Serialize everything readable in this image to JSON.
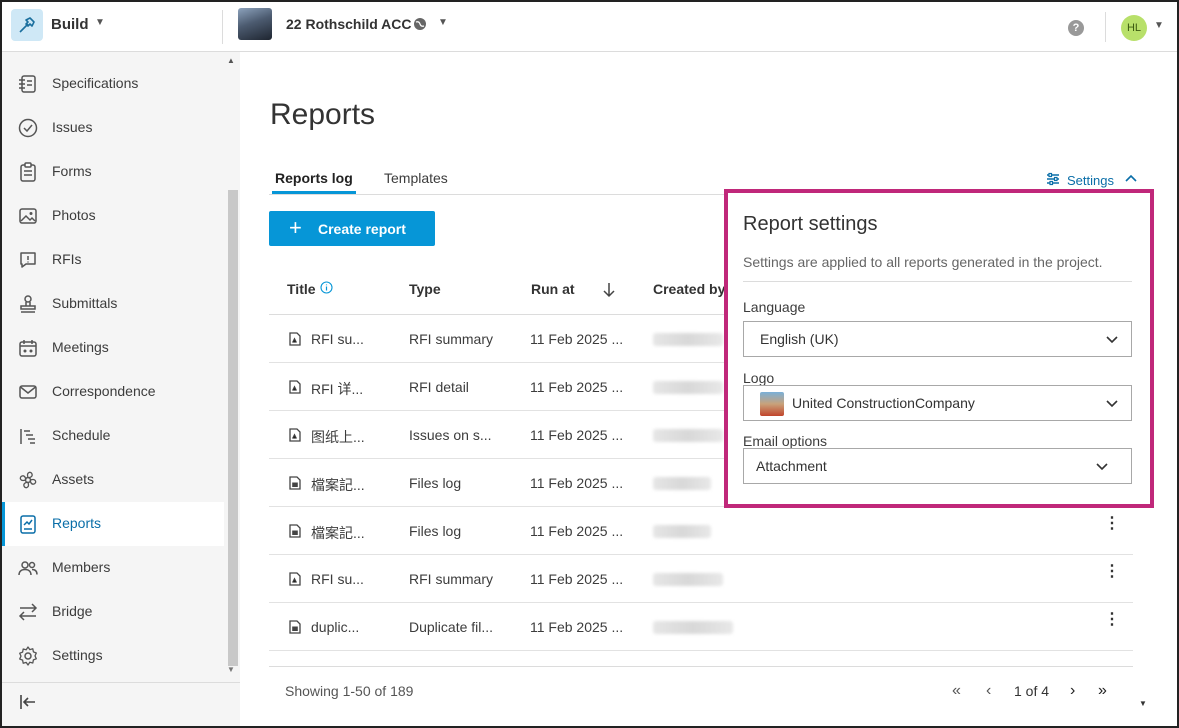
{
  "header": {
    "app_name": "Build",
    "project_name": "22 Rothschild ACC",
    "help_label": "?",
    "user_initials": "HL"
  },
  "sidebar": {
    "items": [
      {
        "label": "Specifications",
        "icon": "specifications-icon"
      },
      {
        "label": "Issues",
        "icon": "issues-icon"
      },
      {
        "label": "Forms",
        "icon": "forms-icon"
      },
      {
        "label": "Photos",
        "icon": "photos-icon"
      },
      {
        "label": "RFIs",
        "icon": "rfis-icon"
      },
      {
        "label": "Submittals",
        "icon": "submittals-icon"
      },
      {
        "label": "Meetings",
        "icon": "meetings-icon"
      },
      {
        "label": "Correspondence",
        "icon": "correspondence-icon"
      },
      {
        "label": "Schedule",
        "icon": "schedule-icon"
      },
      {
        "label": "Assets",
        "icon": "assets-icon"
      },
      {
        "label": "Reports",
        "icon": "reports-icon",
        "active": true
      },
      {
        "label": "Members",
        "icon": "members-icon"
      },
      {
        "label": "Bridge",
        "icon": "bridge-icon"
      },
      {
        "label": "Settings",
        "icon": "settings-icon"
      }
    ]
  },
  "main": {
    "title": "Reports",
    "tabs": [
      "Reports log",
      "Templates"
    ],
    "settings_link": "Settings",
    "create_button": "Create report",
    "columns": [
      "Title",
      "Type",
      "Run at",
      "Created by"
    ],
    "rows": [
      {
        "title": "RFI su...",
        "type": "RFI summary",
        "run_at": "11 Feb 2025 ...",
        "file_icon": "pdf-file-icon"
      },
      {
        "title": "RFI 详...",
        "type": "RFI detail",
        "run_at": "11 Feb 2025 ...",
        "file_icon": "pdf-file-icon"
      },
      {
        "title": "图纸上...",
        "type": "Issues on s...",
        "run_at": "11 Feb 2025 ...",
        "file_icon": "pdf-file-icon"
      },
      {
        "title": "檔案記...",
        "type": "Files log",
        "run_at": "11 Feb 2025 ...",
        "file_icon": "doc-file-icon"
      },
      {
        "title": "檔案記...",
        "type": "Files log",
        "run_at": "11 Feb 2025 ...",
        "file_icon": "doc-file-icon"
      },
      {
        "title": "RFI su...",
        "type": "RFI summary",
        "run_at": "11 Feb 2025 ...",
        "file_icon": "pdf-file-icon"
      },
      {
        "title": "duplic...",
        "type": "Duplicate fil...",
        "run_at": "11 Feb 2025 ...",
        "file_icon": "doc-file-icon"
      }
    ],
    "showing": "Showing 1-50 of 189",
    "page_of": "1 of 4"
  },
  "settings_panel": {
    "title": "Report settings",
    "description": "Settings are applied to all reports generated in the project.",
    "language_label": "Language",
    "language_value": "English (UK)",
    "logo_label": "Logo",
    "logo_value": "United ConstructionCompany",
    "email_label": "Email options",
    "email_value": "Attachment"
  },
  "colors": {
    "accent": "#0696d7",
    "highlight_border": "#c0287a",
    "avatar": "#b8e06a"
  }
}
